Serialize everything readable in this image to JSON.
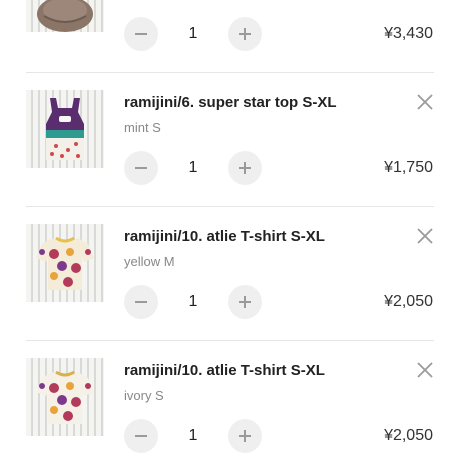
{
  "cart": {
    "items": [
      {
        "image_icon": "product-photo-brown-item",
        "name": "",
        "variant": "",
        "quantity": "1",
        "price": "¥3,430",
        "decrease_icon": "minus-icon",
        "increase_icon": "plus-icon"
      },
      {
        "image_icon": "product-photo-tank-tops",
        "name": "ramijini/6. super star top S-XL",
        "variant": "mint S",
        "quantity": "1",
        "price": "¥1,750",
        "remove_icon": "close-icon",
        "decrease_icon": "minus-icon",
        "increase_icon": "plus-icon"
      },
      {
        "image_icon": "product-photo-floral-tshirt",
        "name": "ramijini/10. atlie T-shirt S-XL",
        "variant": "yellow M",
        "quantity": "1",
        "price": "¥2,050",
        "remove_icon": "close-icon",
        "decrease_icon": "minus-icon",
        "increase_icon": "plus-icon"
      },
      {
        "image_icon": "product-photo-floral-tshirt",
        "name": "ramijini/10. atlie T-shirt S-XL",
        "variant": "ivory S",
        "quantity": "1",
        "price": "¥2,050",
        "remove_icon": "close-icon",
        "decrease_icon": "minus-icon",
        "increase_icon": "plus-icon"
      }
    ]
  },
  "colors": {
    "button_bg": "#efefef",
    "icon_gray": "#9a9a9a",
    "divider": "#e6e6e6",
    "variant_text": "#888888"
  }
}
